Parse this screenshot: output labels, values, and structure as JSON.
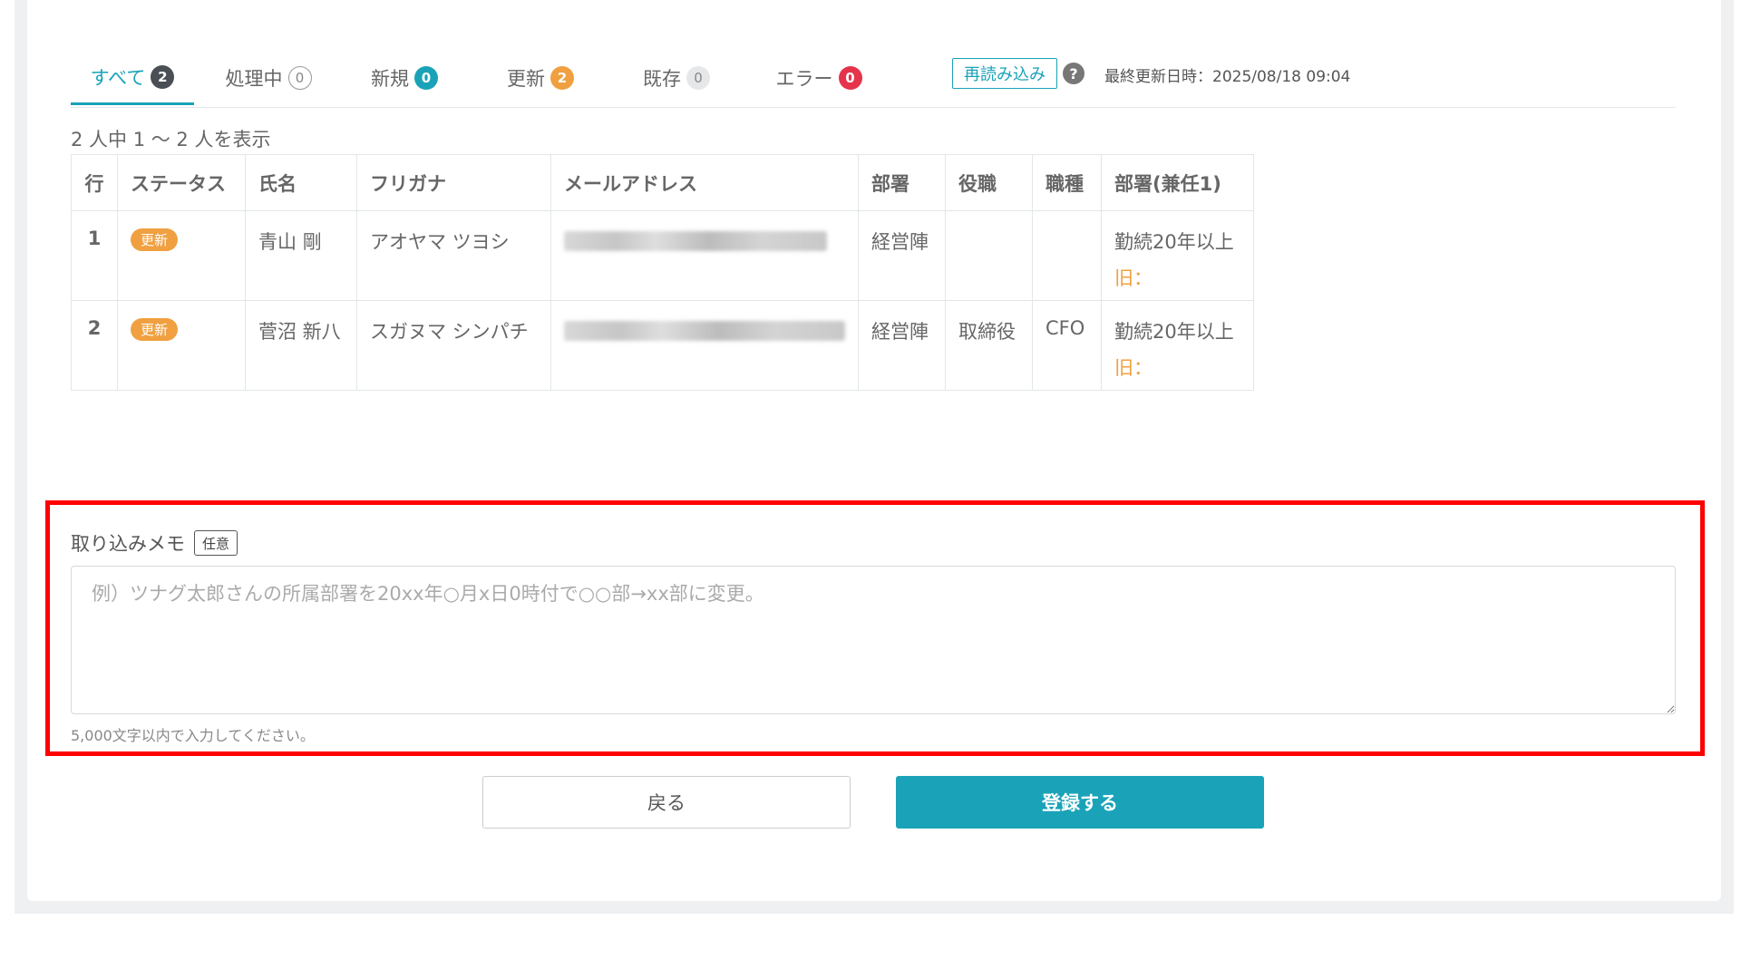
{
  "tabs": [
    {
      "label": "すべて",
      "count": "2"
    },
    {
      "label": "処理中",
      "count": "0"
    },
    {
      "label": "新規",
      "count": "0"
    },
    {
      "label": "更新",
      "count": "2"
    },
    {
      "label": "既存",
      "count": "0"
    },
    {
      "label": "エラー",
      "count": "0"
    }
  ],
  "toolbar": {
    "reload_label": "再読み込み",
    "help_icon": "question-circle-icon",
    "last_updated": "最終更新日時：2025/08/18 09:04"
  },
  "count_text": "2 人中 1 〜 2 人を表示",
  "table": {
    "headers": [
      "行",
      "ステータス",
      "氏名",
      "フリガナ",
      "メールアドレス",
      "部署",
      "役職",
      "職種",
      "部署(兼任1)"
    ],
    "rows": [
      {
        "row": "1",
        "status": "更新",
        "name": "青山 剛",
        "kana": "アオヤマ ツヨシ",
        "dept": "経営陣",
        "role": "",
        "job": "",
        "dept2": "勤続20年以上",
        "old": "旧："
      },
      {
        "row": "2",
        "status": "更新",
        "name": "菅沼 新八",
        "kana": "スガヌマ シンパチ",
        "dept": "経営陣",
        "role": "取締役",
        "job": "CFO",
        "dept2": "勤続20年以上",
        "old": "旧："
      }
    ]
  },
  "memo": {
    "label": "取り込みメモ",
    "optional_tag": "任意",
    "placeholder": "例）ツナグ太郎さんの所属部署を20xx年○月x日0時付で○○部→xx部に変更。",
    "value": "",
    "hint": "5,000文字以内で入力してください。"
  },
  "buttons": {
    "back": "戻る",
    "register": "登録する"
  },
  "colors": {
    "accent": "#1aa3b8",
    "update_badge": "#f0a040",
    "error_badge": "#e5334b",
    "highlight_frame": "#ff0000"
  }
}
